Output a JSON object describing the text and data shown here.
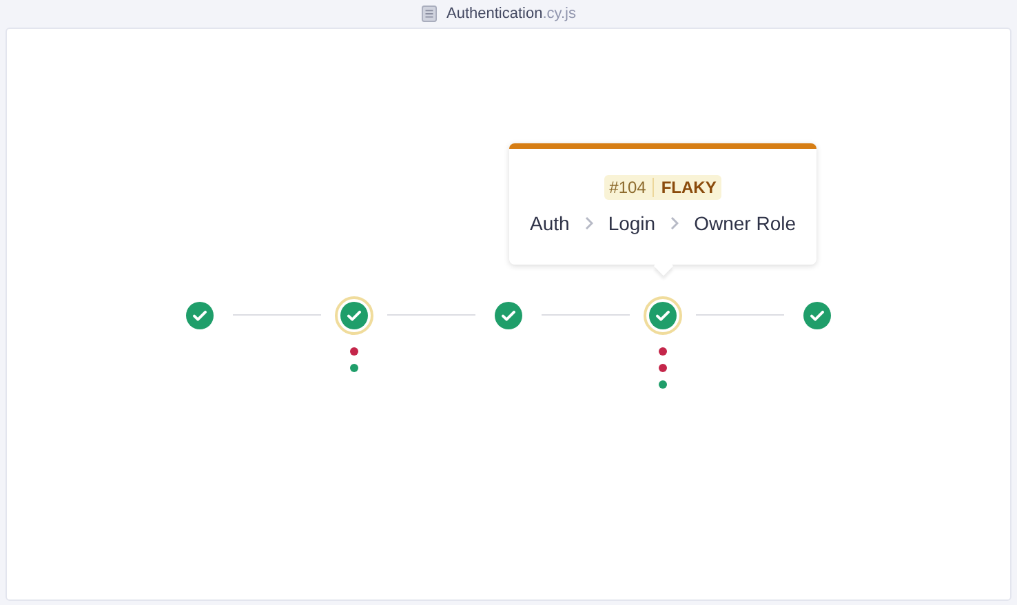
{
  "file": {
    "name": "Authentication",
    "ext": ".cy.js"
  },
  "nodes": [
    {
      "kind": "passed",
      "flaky": false
    },
    {
      "kind": "passed",
      "flaky": true,
      "dots": [
        {
          "color": "#c4264a"
        },
        {
          "color": "#1f9e6a"
        }
      ]
    },
    {
      "kind": "passed",
      "flaky": false
    },
    {
      "kind": "passed",
      "flaky": true,
      "dots": [
        {
          "color": "#c4264a"
        },
        {
          "color": "#c4264a"
        },
        {
          "color": "#1f9e6a"
        }
      ],
      "tooltip": {
        "number": "#104",
        "badge": "FLAKY",
        "path": [
          "Auth",
          "Login",
          "Owner Role"
        ]
      }
    },
    {
      "kind": "passed",
      "flaky": false
    }
  ]
}
